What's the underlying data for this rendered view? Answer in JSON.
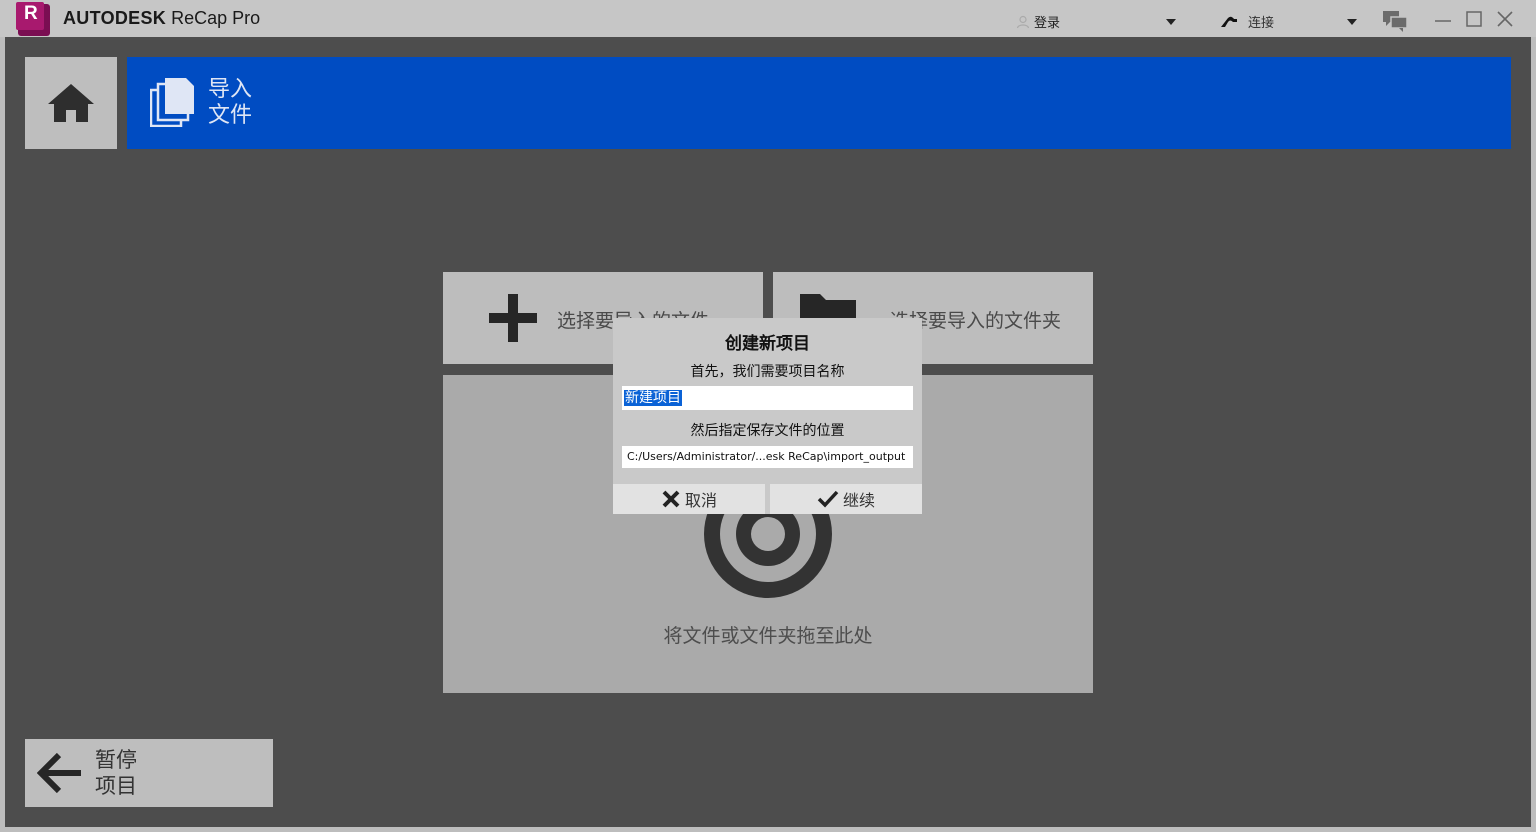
{
  "titlebar": {
    "logo_letter": "R",
    "brand": "AUTODESK",
    "product": "ReCap Pro",
    "login_label": "登录",
    "connect_label": "连接"
  },
  "header": {
    "line1": "导入",
    "line2": "文件"
  },
  "tiles": {
    "select_files": "选择要导入的文件",
    "select_folder": "选择要导入的文件夹",
    "drop_hint": "将文件或文件夹拖至此处"
  },
  "dialog": {
    "title": "创建新项目",
    "name_prompt": "首先，我们需要项目名称",
    "name_value": "新建项目",
    "location_prompt": "然后指定保存文件的位置",
    "location_value": "C:/Users/Administrator/...esk ReCap\\import_output",
    "cancel_label": "取消",
    "continue_label": "继续"
  },
  "back": {
    "line1": "暂停",
    "line2": "项目"
  },
  "colors": {
    "header_blue": "#004cc2",
    "workspace": "#4d4d4d",
    "tile": "#bdbdbd"
  }
}
